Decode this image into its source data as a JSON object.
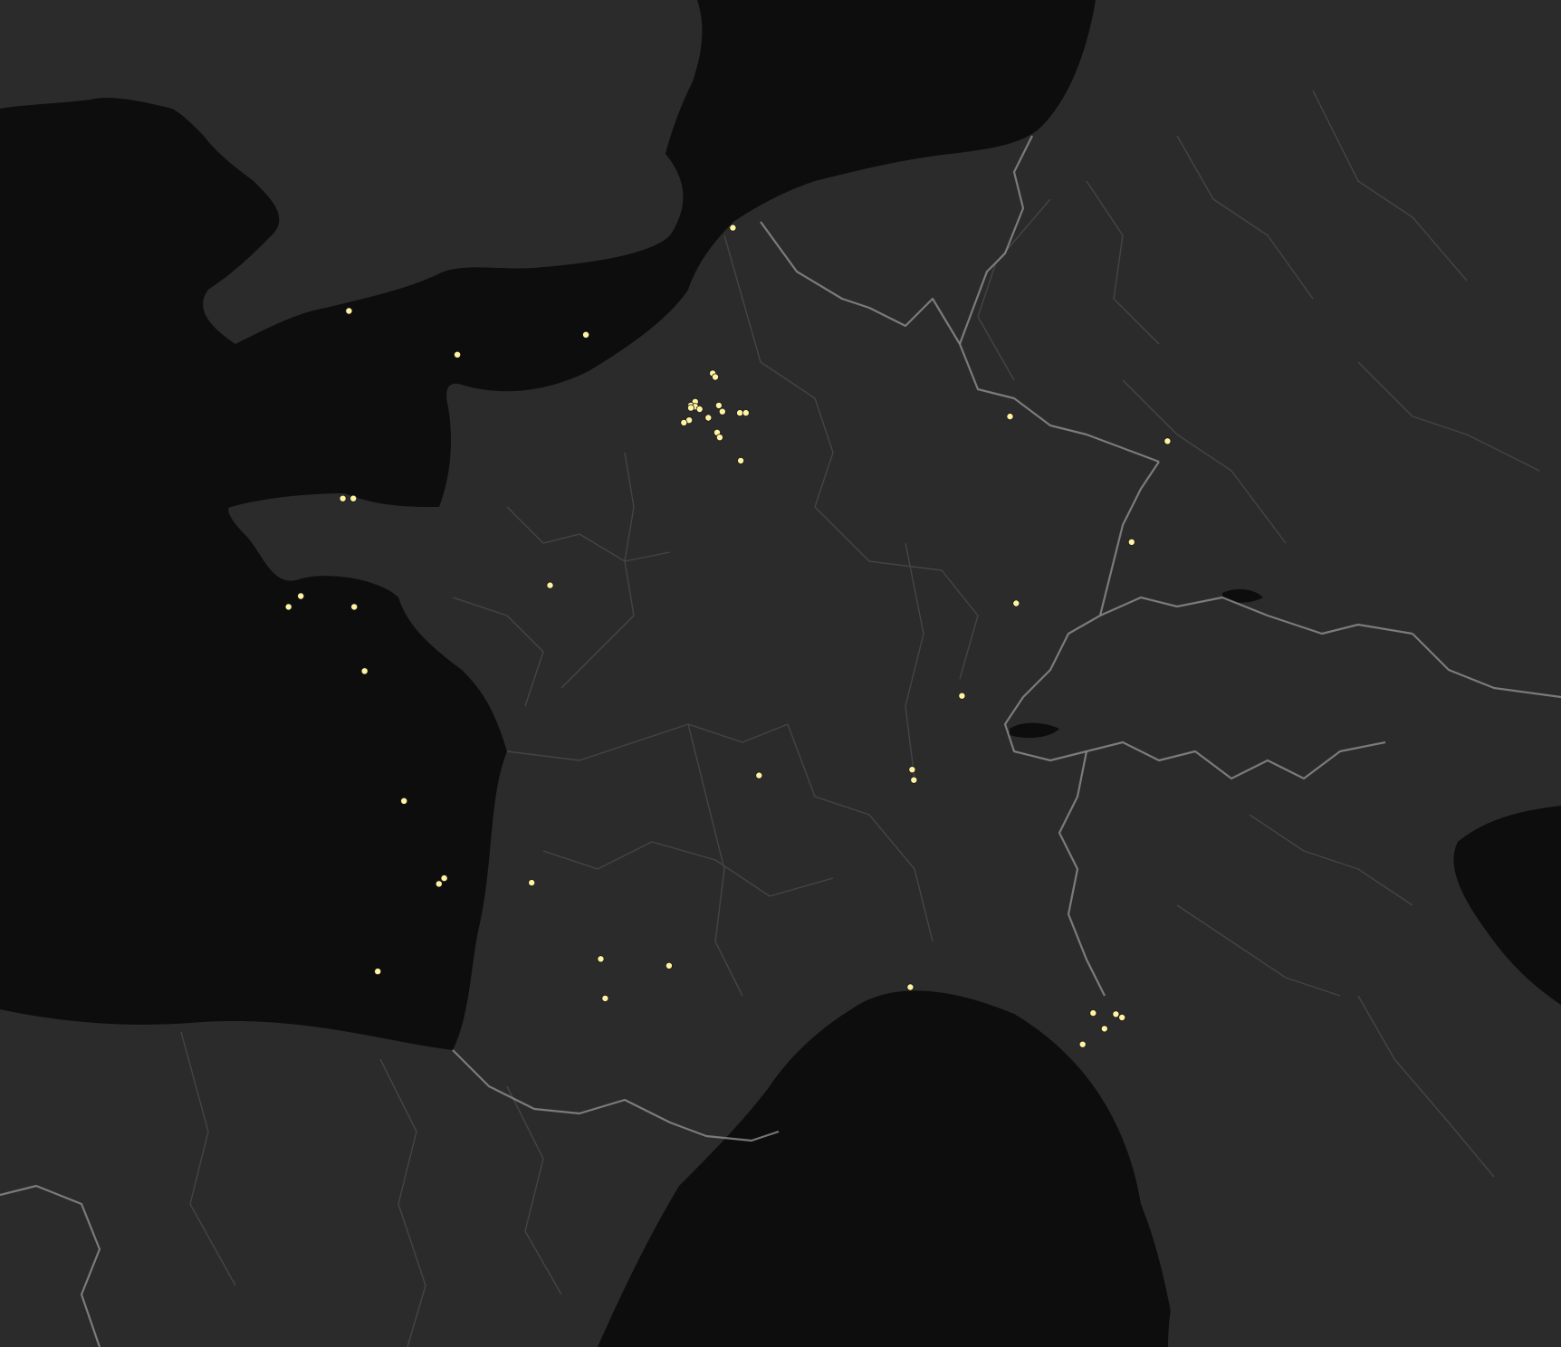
{
  "map": {
    "style": "dark basemap",
    "colors": {
      "water": "#0d0d0d",
      "land": "#2b2b2b",
      "country_border": "#8a8a8a",
      "region_border": "#444444",
      "marker": "#fff3a3"
    },
    "markers": [
      {
        "lat": 50.29,
        "lon": 2.78
      },
      {
        "lat": 49.44,
        "lon": 1.1
      },
      {
        "lat": 49.28,
        "lon": -0.37
      },
      {
        "lat": 49.63,
        "lon": -1.61
      },
      {
        "lat": 49.13,
        "lon": 2.55
      },
      {
        "lat": 49.1,
        "lon": 2.58
      },
      {
        "lat": 48.9,
        "lon": 2.35
      },
      {
        "lat": 48.87,
        "lon": 2.3
      },
      {
        "lat": 48.86,
        "lon": 2.35
      },
      {
        "lat": 48.84,
        "lon": 2.4
      },
      {
        "lat": 48.85,
        "lon": 2.3
      },
      {
        "lat": 48.87,
        "lon": 2.62
      },
      {
        "lat": 48.82,
        "lon": 2.66
      },
      {
        "lat": 48.81,
        "lon": 2.86
      },
      {
        "lat": 48.81,
        "lon": 2.93
      },
      {
        "lat": 48.77,
        "lon": 2.5
      },
      {
        "lat": 48.75,
        "lon": 2.28
      },
      {
        "lat": 48.73,
        "lon": 2.22
      },
      {
        "lat": 48.65,
        "lon": 2.6
      },
      {
        "lat": 48.61,
        "lon": 2.63
      },
      {
        "lat": 48.42,
        "lon": 2.87
      },
      {
        "lat": 48.78,
        "lon": 5.95
      },
      {
        "lat": 48.58,
        "lon": 7.75
      },
      {
        "lat": 47.75,
        "lon": 7.34
      },
      {
        "lat": 47.24,
        "lon": 6.02
      },
      {
        "lat": 48.11,
        "lon": -1.68
      },
      {
        "lat": 48.11,
        "lon": -1.56
      },
      {
        "lat": 47.3,
        "lon": -2.16
      },
      {
        "lat": 47.21,
        "lon": -2.3
      },
      {
        "lat": 47.21,
        "lon": -1.55
      },
      {
        "lat": 47.39,
        "lon": 0.69
      },
      {
        "lat": 46.67,
        "lon": -1.43
      },
      {
        "lat": 46.46,
        "lon": 5.4
      },
      {
        "lat": 45.83,
        "lon": 4.83
      },
      {
        "lat": 45.74,
        "lon": 4.85
      },
      {
        "lat": 45.78,
        "lon": 3.08
      },
      {
        "lat": 45.56,
        "lon": -0.98
      },
      {
        "lat": 44.89,
        "lon": -0.52
      },
      {
        "lat": 44.84,
        "lon": -0.58
      },
      {
        "lat": 44.85,
        "lon": 0.48
      },
      {
        "lat": 44.07,
        "lon": -1.28
      },
      {
        "lat": 44.18,
        "lon": 1.27
      },
      {
        "lat": 44.12,
        "lon": 2.05
      },
      {
        "lat": 43.83,
        "lon": 1.32
      },
      {
        "lat": 43.93,
        "lon": 4.81
      },
      {
        "lat": 43.7,
        "lon": 6.9
      },
      {
        "lat": 43.69,
        "lon": 7.16
      },
      {
        "lat": 43.66,
        "lon": 7.23
      },
      {
        "lat": 43.56,
        "lon": 7.03
      },
      {
        "lat": 43.42,
        "lon": 6.78
      }
    ]
  }
}
